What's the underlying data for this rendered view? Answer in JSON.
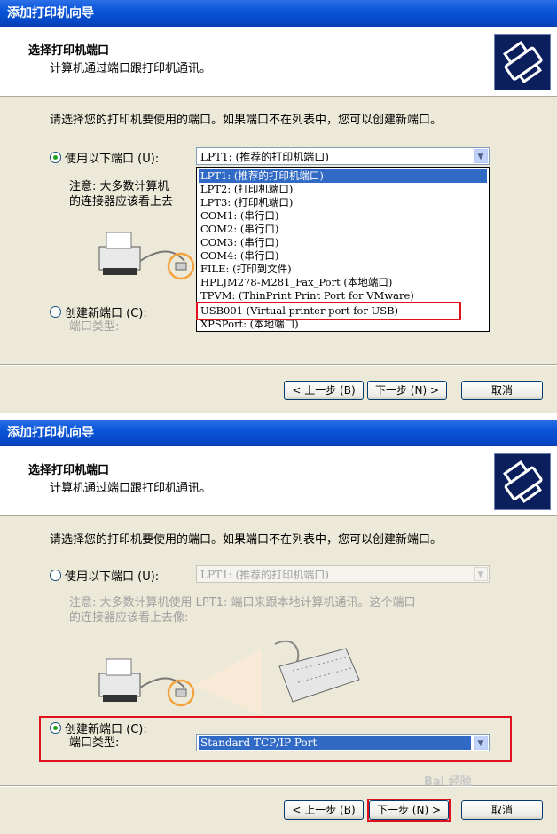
{
  "window_title": "添加打印机向导",
  "header": {
    "title": "选择打印机端口",
    "subtitle": "计算机通过端口跟打印机通讯。"
  },
  "intro_text": "请选择您的打印机要使用的端口。如果端口不在列表中，您可以创建新端口。",
  "existing_port": {
    "label": "使用以下端口 (U):",
    "selected_value": "LPT1: (推荐的打印机端口)",
    "options": [
      "LPT1: (推荐的打印机端口)",
      "LPT2: (打印机端口)",
      "LPT3: (打印机端口)",
      "COM1: (串行口)",
      "COM2: (串行口)",
      "COM3: (串行口)",
      "COM4: (串行口)",
      "FILE: (打印到文件)",
      "HPLJM278-M281_Fax_Port (本地端口)",
      "TPVM: (ThinPrint Print Port for VMware)",
      "USB001 (Virtual printer port for USB)",
      "XPSPort: (本地端口)"
    ],
    "highlighted_option": "USB001 (Virtual printer port for USB)"
  },
  "note_text_top": {
    "line1": "注意: 大多数计算机",
    "line2": "的连接器应该看上去"
  },
  "note_text_bottom": {
    "line1": "注意: 大多数计算机使用 LPT1: 端口来跟本地计算机通讯。这个端口",
    "line2": "的连接器应该看上去像:"
  },
  "new_port": {
    "label": "创建新端口 (C):",
    "type_label": "端口类型:",
    "type_value": "Standard TCP/IP Port"
  },
  "buttons": {
    "back": "< 上一步 (B)",
    "next": "下一步 (N) >",
    "cancel": "取消"
  },
  "top_panel_state": {
    "use_existing_selected": true,
    "create_new_selected": false
  },
  "bottom_panel_state": {
    "use_existing_selected": false,
    "create_new_selected": true
  },
  "watermark": "Bai 经验",
  "colors": {
    "titlebar": "#0a55d8",
    "dialog_bg": "#ece9d8",
    "highlight": "#316ac5",
    "annotation_red": "#e2101c"
  }
}
